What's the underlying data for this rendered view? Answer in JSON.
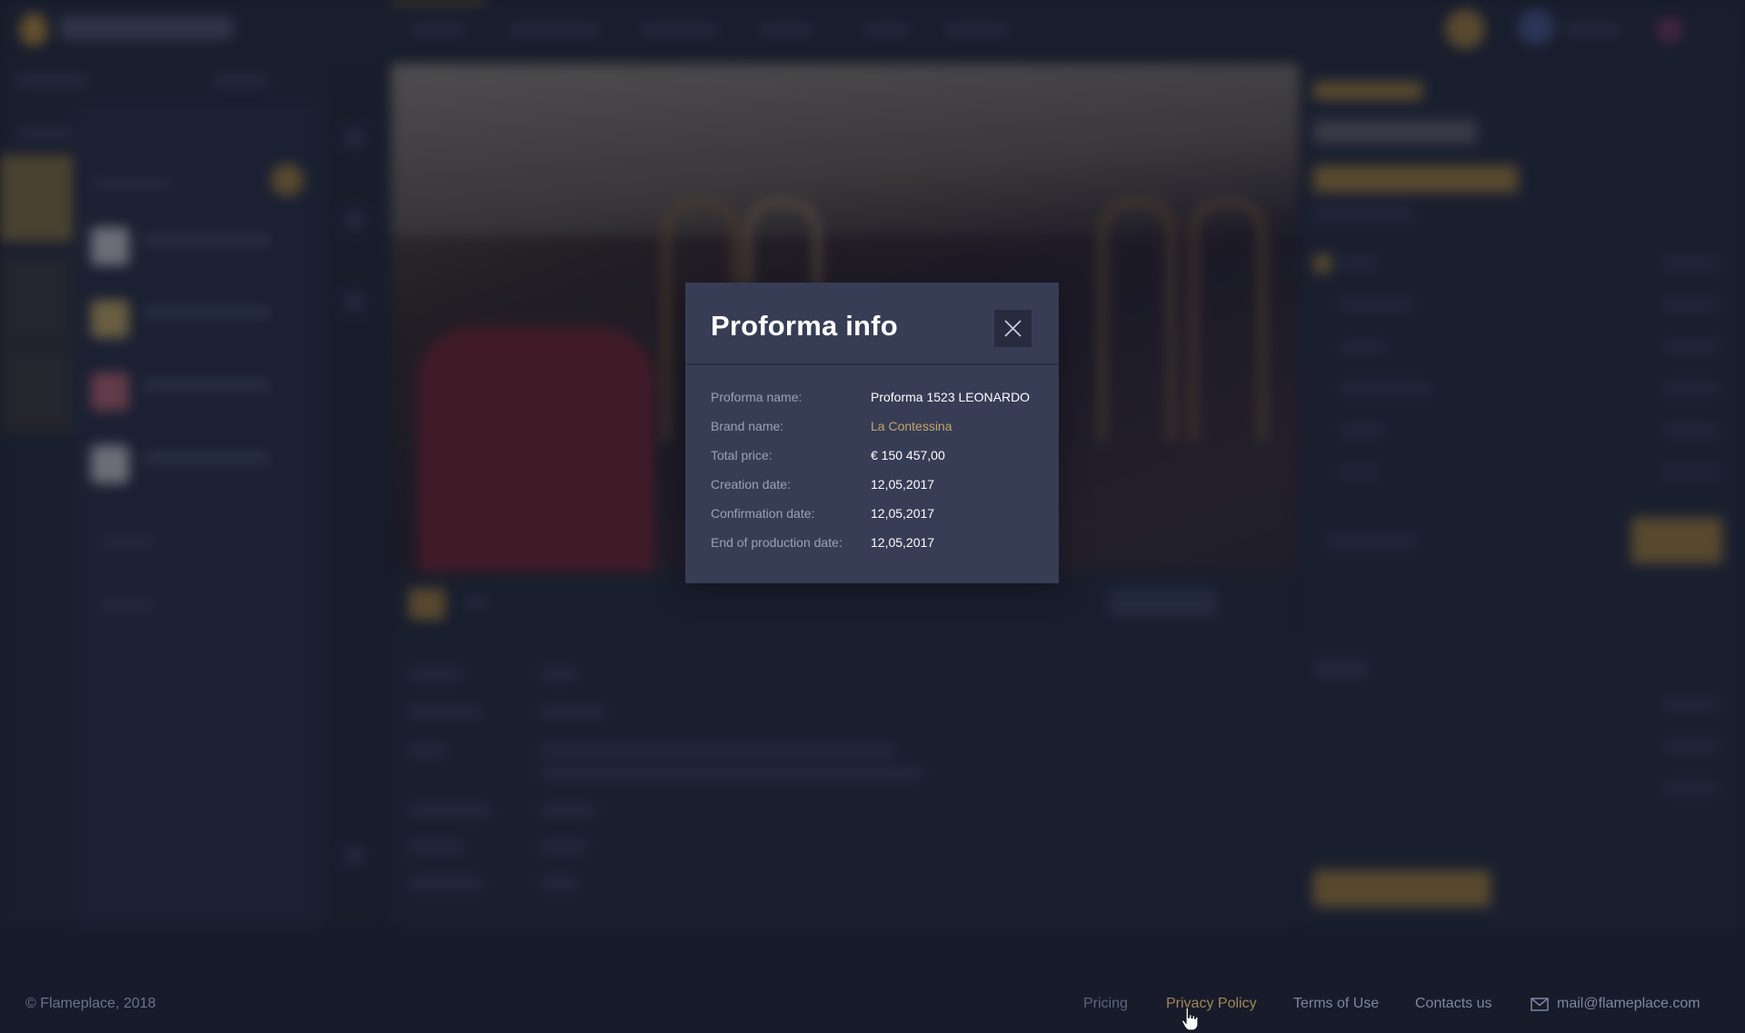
{
  "modal": {
    "title": "Proforma info",
    "rows": [
      {
        "label": "Proforma name:",
        "value": "Proforma 1523 LEONARDO"
      },
      {
        "label": "Brand name:",
        "value": "La Contessina"
      },
      {
        "label": "Total price:",
        "value": "€ 150 457,00"
      },
      {
        "label": "Creation date:",
        "value": "12,05,2017"
      },
      {
        "label": "Confirmation date:",
        "value": "12,05,2017"
      },
      {
        "label": "End of production date:",
        "value": "12,05,2017"
      }
    ]
  },
  "footer": {
    "copyright": "© Flameplace, 2018",
    "links": [
      "Pricing",
      "Privacy Policy",
      "Terms of Use",
      "Contacts us"
    ],
    "email": "mail@flameplace.com"
  },
  "colors": {
    "background": "#1f2436",
    "modal_bg": "#363d55",
    "accent_gold": "#c9a36a",
    "close_bg": "#262c3e"
  },
  "icons": [
    "close-icon",
    "mail-icon",
    "hand-cursor-icon"
  ]
}
